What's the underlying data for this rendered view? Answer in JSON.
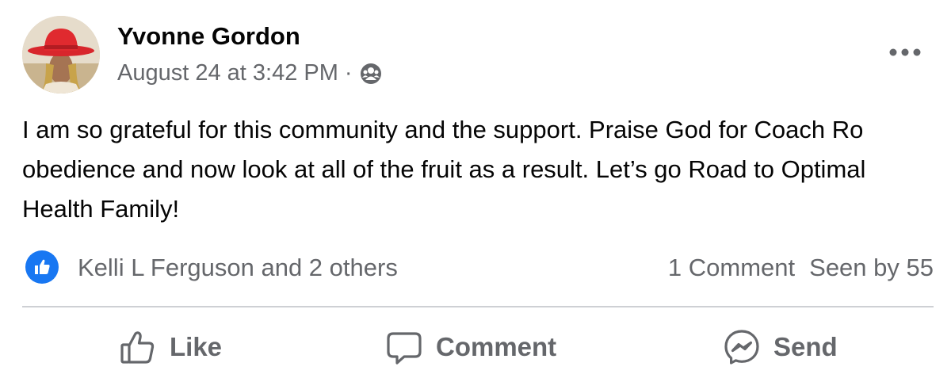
{
  "post": {
    "author": {
      "name": "Yvonne Gordon",
      "avatar_icon": "profile-photo"
    },
    "timestamp": "August 24 at 3:42 PM",
    "separator": "·",
    "audience_icon": "group-icon",
    "more_icon": "ellipsis-icon",
    "text": "I am so grateful for this community and the support. Praise God for Coach Ro obedience and now look at all of the fruit as a result. Let’s go Road to Optimal Health Family!"
  },
  "stats": {
    "reaction_icon": "like-reaction-icon",
    "reactors": "Kelli L Ferguson and 2 others",
    "comments": "1 Comment",
    "seen_by": "Seen by 55"
  },
  "actions": {
    "like_label": "Like",
    "comment_label": "Comment",
    "send_label": "Send"
  },
  "colors": {
    "primary_text": "#050505",
    "secondary_text": "#65676b",
    "divider": "#ced0d4",
    "like_blue": "#1877f2"
  }
}
